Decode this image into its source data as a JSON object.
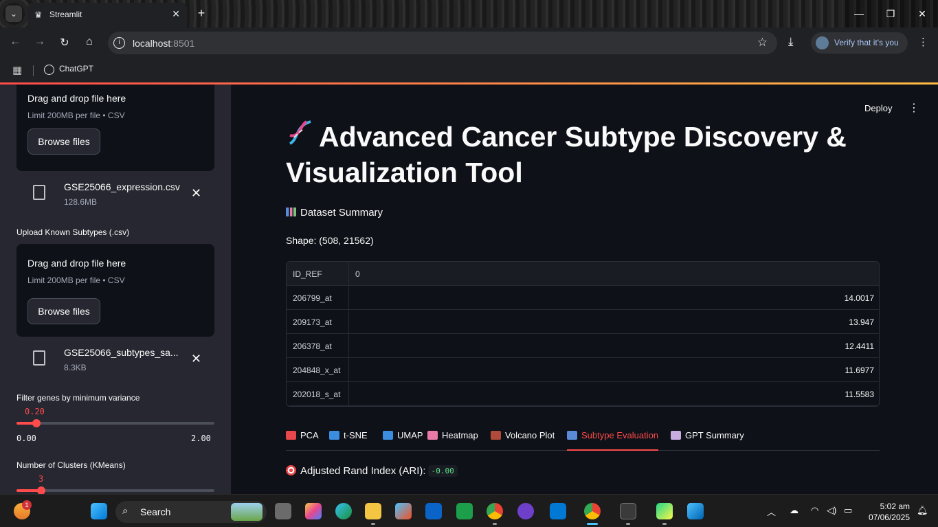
{
  "browser": {
    "tab_title": "Streamlit",
    "url_host": "localhost",
    "url_port": ":8501",
    "verify_label": "Verify that it's you",
    "bookmark": "ChatGPT"
  },
  "sidebar": {
    "upload1": {
      "drop_text": "Drag and drop file here",
      "limit_text": "Limit 200MB per file • CSV",
      "browse_label": "Browse files",
      "file_name": "GSE25066_expression.csv",
      "file_size": "128.6MB"
    },
    "upload2_label": "Upload Known Subtypes (.csv)",
    "upload2": {
      "drop_text": "Drag and drop file here",
      "limit_text": "Limit 200MB per file • CSV",
      "browse_label": "Browse files",
      "file_name": "GSE25066_subtypes_sa...",
      "file_size": "8.3KB"
    },
    "variance": {
      "label": "Filter genes by minimum variance",
      "value": "0.20",
      "min": "0.00",
      "max": "2.00",
      "fraction": 0.1
    },
    "clusters": {
      "label": "Number of Clusters (KMeans)",
      "value": "3"
    }
  },
  "main": {
    "deploy_label": "Deploy",
    "title": "Advanced Cancer Subtype Discovery & Visualization Tool",
    "summary_heading": "Dataset Summary",
    "shape_text": "Shape: (508, 21562)",
    "table": {
      "columns": [
        "ID_REF",
        "0"
      ],
      "rows": [
        [
          "206799_at",
          "14.0017"
        ],
        [
          "209173_at",
          "13.947"
        ],
        [
          "206378_at",
          "12.4411"
        ],
        [
          "204848_x_at",
          "11.6977"
        ],
        [
          "202018_s_at",
          "11.5583"
        ]
      ]
    },
    "tabs": [
      {
        "label": "PCA",
        "icon": "pushpin-icon",
        "color": "#e8474b"
      },
      {
        "label": "t-SNE",
        "icon": "cycle-icon",
        "color": "#3b8de0"
      },
      {
        "label": "UMAP",
        "icon": "shuffle-icon",
        "color": "#3b8de0"
      },
      {
        "label": "Heatmap",
        "icon": "heatmap-icon",
        "color": "#e87aa8"
      },
      {
        "label": "Volcano Plot",
        "icon": "volcano-icon",
        "color": "#b04a3a"
      },
      {
        "label": "Subtype Evaluation",
        "icon": "bar-chart-icon",
        "color": "#5b8ad6"
      },
      {
        "label": "GPT Summary",
        "icon": "robot-icon",
        "color": "#c8aee0"
      }
    ],
    "active_tab": "Subtype Evaluation",
    "ari_label": "Adjusted Rand Index (ARI):",
    "ari_value": "-0.00"
  },
  "taskbar": {
    "search_label": "Search",
    "notification_count": "1",
    "time": "5:02 am",
    "date": "07/06/2025"
  }
}
